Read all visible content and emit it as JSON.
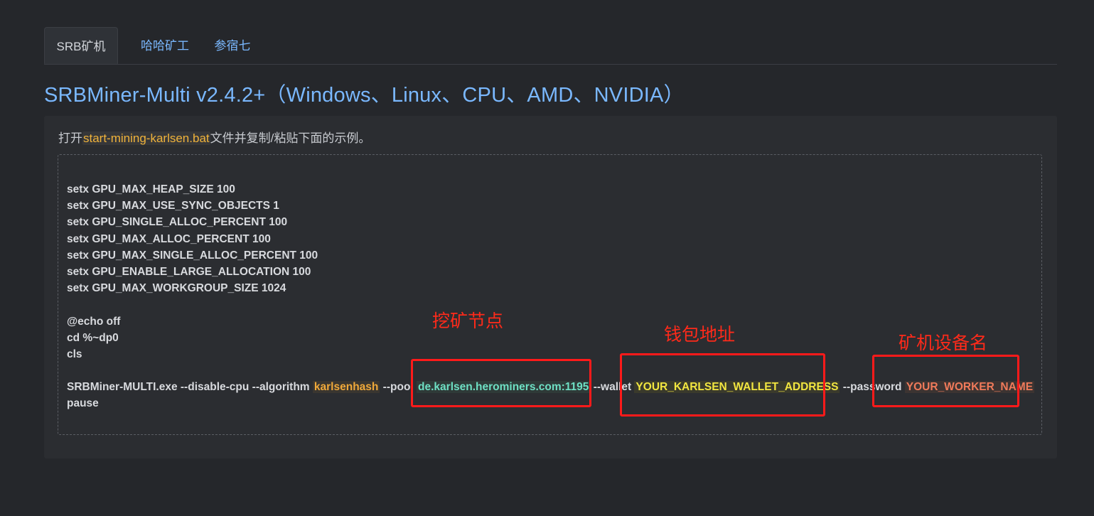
{
  "tabs": [
    {
      "label": "SRB矿机",
      "active": true
    },
    {
      "label": "哈哈矿工",
      "active": false
    },
    {
      "label": "参宿七",
      "active": false
    }
  ],
  "title": "SRBMiner-Multi v2.4.2+（Windows、Linux、CPU、AMD、NVIDIA）",
  "intro": {
    "prefix": "打开",
    "filename": "start-mining-karlsen.bat",
    "suffix": "文件并复制/粘贴下面的示例。"
  },
  "code": {
    "setx_lines": [
      "setx GPU_MAX_HEAP_SIZE 100",
      "setx GPU_MAX_USE_SYNC_OBJECTS 1",
      "setx GPU_SINGLE_ALLOC_PERCENT 100",
      "setx GPU_MAX_ALLOC_PERCENT 100",
      "setx GPU_MAX_SINGLE_ALLOC_PERCENT 100",
      "setx GPU_ENABLE_LARGE_ALLOCATION 100",
      "setx GPU_MAX_WORKGROUP_SIZE 1024"
    ],
    "echo_line": "@echo off",
    "cd_line": "cd %~dp0",
    "cls_line": "cls",
    "cmd_exe": "SRBMiner-MULTI.exe --disable-cpu --algorithm ",
    "algorithm": "karlsenhash",
    "pool_flag": " --pool ",
    "pool": "de.karlsen.herominers.com:1195",
    "wallet_flag": " --wallet ",
    "wallet": "YOUR_KARLSEN_WALLET_ADDRESS",
    "password_flag": " --password ",
    "worker": "YOUR_WORKER_NAME",
    "pause_line": "pause"
  },
  "annotations": {
    "pool_label": "挖矿节点",
    "wallet_label": "钱包地址",
    "worker_label": "矿机设备名",
    "color": "#ff1a1a"
  }
}
